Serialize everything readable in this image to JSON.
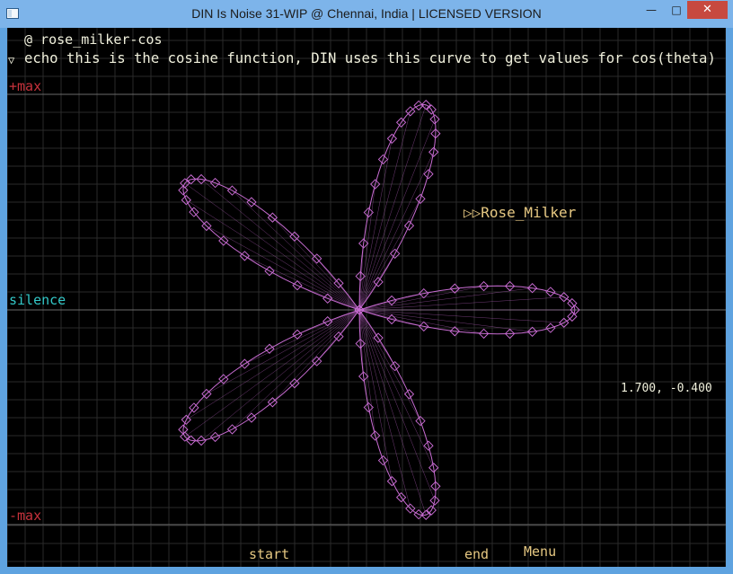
{
  "window": {
    "title": "DIN Is Noise 31-WIP @ Chennai, India | LICENSED VERSION",
    "minimize_icon": "minimize-icon",
    "maximize_icon": "maximize-icon",
    "close_icon": "close-icon"
  },
  "console": {
    "line1": "@ rose_milker-cos",
    "line2": "echo this is the cosine function, DIN uses this curve to get values for cos(theta)",
    "collapse_icon": "triangle-down-icon"
  },
  "labels": {
    "plus_max": "+max",
    "silence": "silence",
    "minus_max": "-max",
    "start": "start",
    "end": "end",
    "menu": "Menu",
    "curve_name": "Rose_Milker",
    "coords": "1.700, -0.400"
  },
  "colors": {
    "curve": "#c86cd2",
    "plus_max": "#c8323c",
    "silence": "#33c8c8",
    "console_text": "#f0f0dc",
    "label_yellow": "#e6c882",
    "grid": "#2a2a2a"
  }
}
